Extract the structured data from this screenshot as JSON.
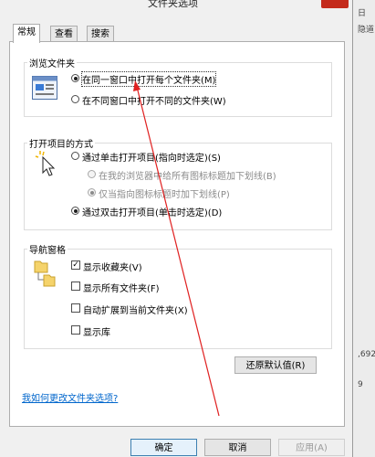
{
  "window": {
    "title": "文件夹选项"
  },
  "side_panel": {
    "text_top": "日",
    "text_mid": "隐道",
    "text_low": ",692",
    "text_lower": "9"
  },
  "tabs": [
    {
      "label": "常规"
    },
    {
      "label": "查看"
    },
    {
      "label": "搜索"
    }
  ],
  "browse": {
    "legend": "浏览文件夹",
    "options": [
      {
        "label": "在同一窗口中打开每个文件夹(M)",
        "selected": true
      },
      {
        "label": "在不同窗口中打开不同的文件夹(W)",
        "selected": false
      }
    ]
  },
  "open_items": {
    "legend": "打开项目的方式",
    "options": [
      {
        "label": "通过单击打开项目(指向时选定)(S)",
        "selected": false
      },
      {
        "label": "在我的浏览器中给所有图标标题加下划线(B)",
        "selected": false,
        "disabled": true
      },
      {
        "label": "仅当指向图标标题时加下划线(P)",
        "selected": true,
        "disabled": true
      },
      {
        "label": "通过双击打开项目(单击时选定)(D)",
        "selected": true
      }
    ]
  },
  "nav_pane": {
    "legend": "导航窗格",
    "options": [
      {
        "label": "显示收藏夹(V)",
        "checked": true
      },
      {
        "label": "显示所有文件夹(F)",
        "checked": false
      },
      {
        "label": "自动扩展到当前文件夹(X)",
        "checked": false
      },
      {
        "label": "显示库",
        "checked": false
      }
    ]
  },
  "restore_button": "还原默认值(R)",
  "help_link": "我如何更改文件夹选项?",
  "footer": {
    "ok": "确定",
    "cancel": "取消",
    "apply": "应用(A)"
  },
  "colors": {
    "accent": "#3c7fb1",
    "link": "#0066cc",
    "annotation_arrow": "#e02020",
    "close": "#c42b1c"
  },
  "icons": {
    "browse": "window-icon",
    "open": "cursor-click-icon",
    "nav": "folder-tree-icon"
  }
}
